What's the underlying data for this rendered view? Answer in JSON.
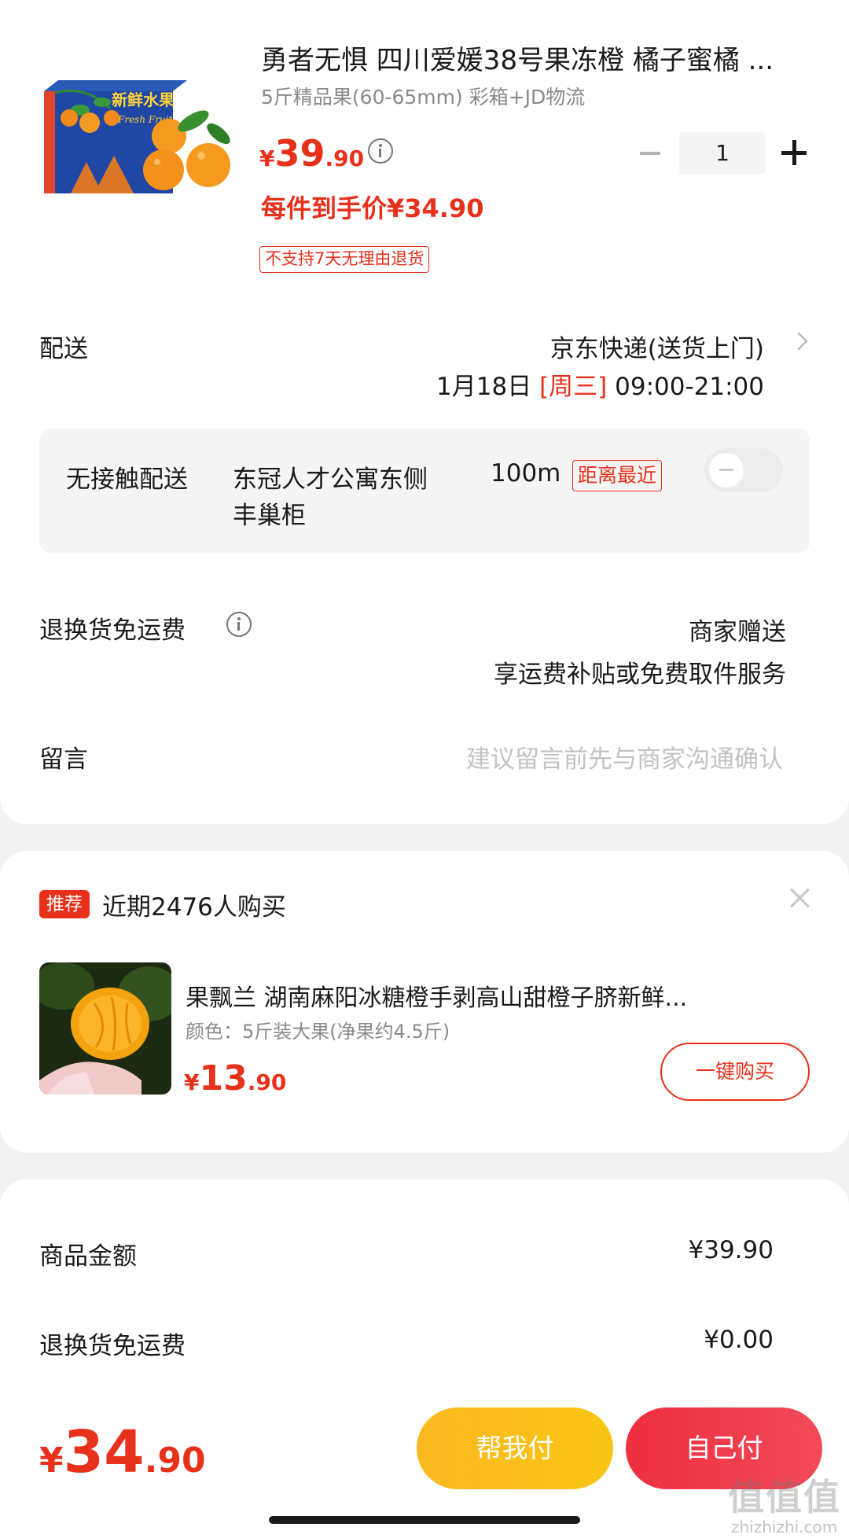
{
  "product": {
    "image_text": {
      "cn": "新鲜水果",
      "en": "Fresh Fruit"
    },
    "title": "勇者无惧 四川爱媛38号果冻橙 橘子蜜橘 ...",
    "spec": "5斤精品果(60-65mm) 彩箱+JD物流",
    "price": {
      "yen": "¥",
      "int": "39",
      "dec": ".90"
    },
    "final_price": "每件到手价¥34.90",
    "quantity": "1",
    "no_return_tag": "不支持7天无理由退货"
  },
  "delivery": {
    "label": "配送",
    "method": "京东快递(送货上门)",
    "date": "1月18日 ",
    "weekday": "[周三]",
    "time": " 09:00-21:00",
    "contactless_label": "无接触配送",
    "locker_line1": "东冠人才公寓东侧",
    "locker_line2": "丰巢柜",
    "distance": "100m",
    "distance_tag": "距离最近",
    "toggle_on": false
  },
  "return_shipping": {
    "label": "退换货免运费",
    "value_line1": "商家赠送",
    "value_line2": "享运费补贴或免费取件服务"
  },
  "message": {
    "label": "留言",
    "placeholder": "建议留言前先与商家沟通确认"
  },
  "recommend": {
    "badge": "推荐",
    "title": "近期2476人购买",
    "item_name": "果飘兰 湖南麻阳冰糖橙手剥高山甜橙子脐新鲜...",
    "item_spec": "颜色：5斤装大果(净果约4.5斤)",
    "price": {
      "yen": "¥",
      "int": "13",
      "dec": ".90"
    },
    "buy_label": "一键购买"
  },
  "summary": {
    "goods_label": "商品金额",
    "goods_value": "¥39.90",
    "shipping_label": "退换货免运费",
    "shipping_value": "¥0.00"
  },
  "footer": {
    "total": {
      "yen": "¥",
      "int": "34",
      "dec": ".90"
    },
    "help_pay_label": "帮我付",
    "self_pay_label": "自己付"
  },
  "watermark": {
    "main": "值值值",
    "sub": "zhizhizhi.com"
  },
  "colors": {
    "accent_red": "#e8311b",
    "pay_red": "#ee2f3f",
    "pay_yellow": "#fbb921"
  }
}
